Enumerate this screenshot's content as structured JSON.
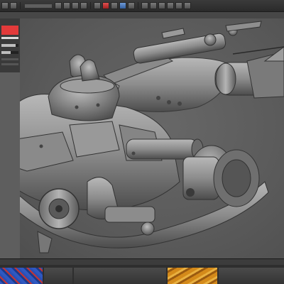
{
  "app": {
    "name": ""
  },
  "toolbar": {
    "buttons": [
      "tool-1",
      "tool-2",
      "tool-3",
      "tool-4",
      "tool-5",
      "tool-6",
      "tool-7",
      "tool-8",
      "tool-9",
      "tool-10",
      "tool-11",
      "tool-12",
      "tool-13",
      "tool-14",
      "tool-15",
      "tool-16",
      "tool-17",
      "tool-18"
    ]
  },
  "left_panel": {
    "active_color": "#e23a3a",
    "slider_levels": [
      0.85,
      0.55
    ]
  },
  "viewport": {
    "background": "#5e5e5e",
    "subject": "mech-sculpt"
  },
  "dock": {
    "thumbnails": [
      "thumb-blue-texture",
      "thumb-grey",
      "thumb-orange-texture",
      "thumb-grey-2"
    ]
  }
}
